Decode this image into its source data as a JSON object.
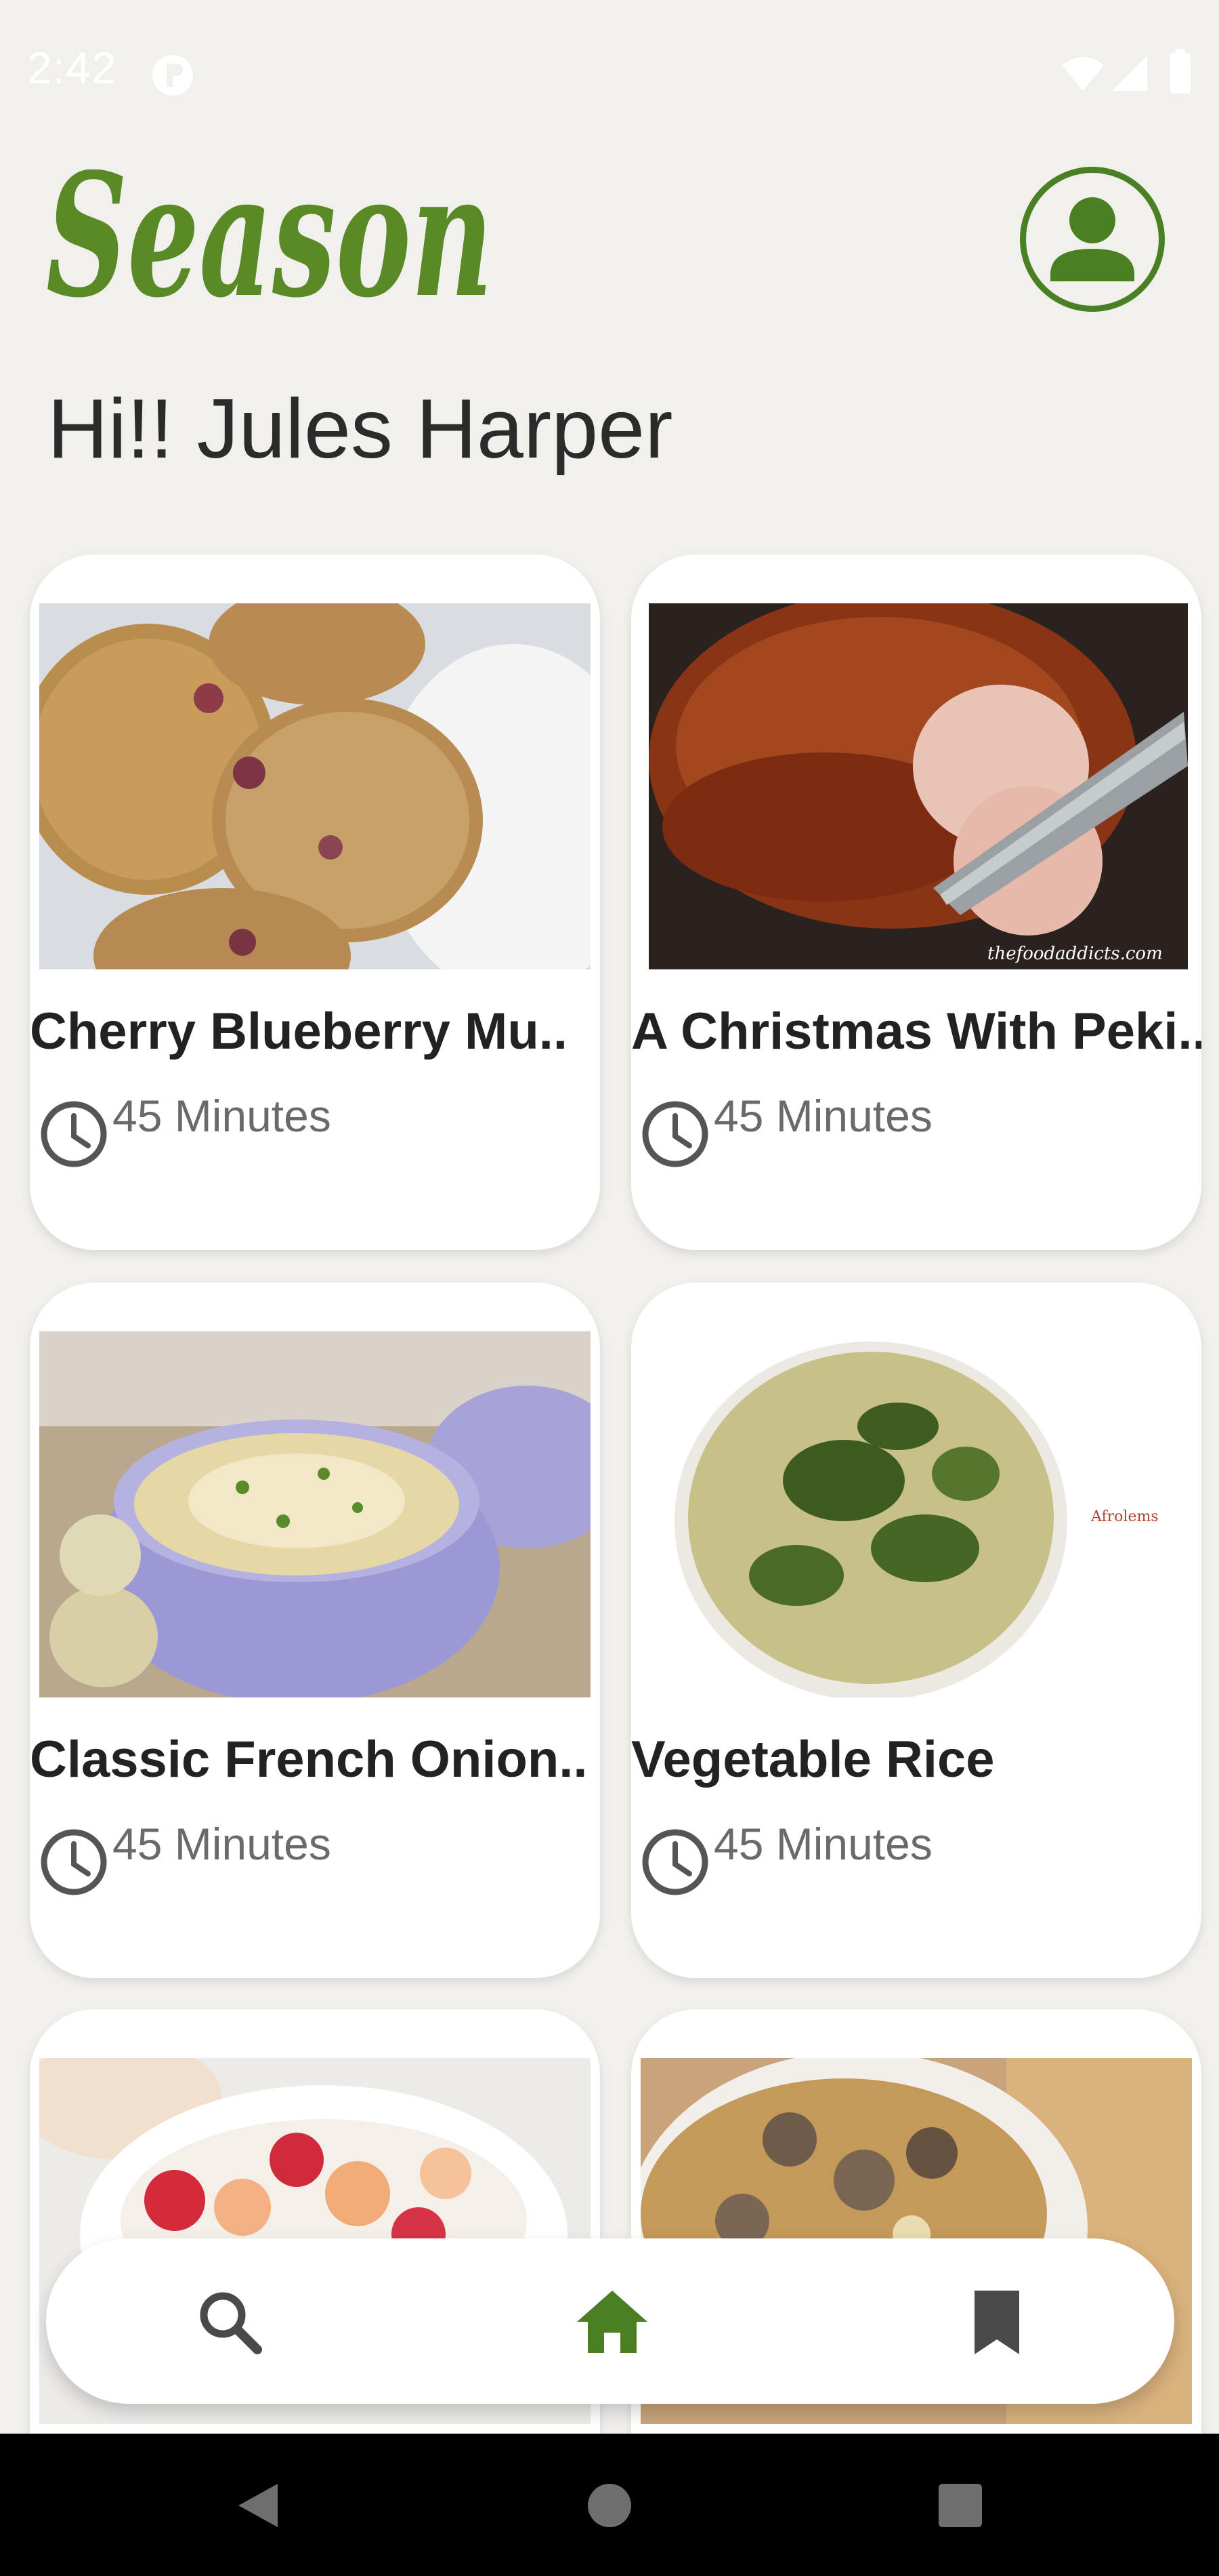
{
  "status_bar": {
    "time": "2:42",
    "icons": [
      "app-notification-icon",
      "wifi-icon",
      "cell-signal-icon",
      "battery-icon"
    ]
  },
  "header": {
    "logo_text": "Season",
    "greeting": "Hi!! Jules Harper",
    "profile_icon": "account-circle-icon"
  },
  "recipes": [
    {
      "title": "Cherry Blueberry Mu..",
      "time": "45 Minutes",
      "image": "muffins-photo"
    },
    {
      "title": "A Christmas With Peki..",
      "time": "45 Minutes",
      "image": "roast-duck-photo",
      "watermark": "thefoodaddicts.com"
    },
    {
      "title": "Classic French Onion..",
      "time": "45 Minutes",
      "image": "onion-soup-photo"
    },
    {
      "title": "Vegetable Rice",
      "time": "45 Minutes",
      "image": "vegetable-rice-photo",
      "watermark": "Afrolems"
    },
    {
      "title": "",
      "time": "",
      "image": "fruit-salad-photo"
    },
    {
      "title": "",
      "time": "",
      "image": "meat-dish-photo"
    }
  ],
  "bottom_nav": {
    "items": [
      {
        "icon": "search-icon",
        "active": false
      },
      {
        "icon": "home-icon",
        "active": true
      },
      {
        "icon": "bookmark-icon",
        "active": false
      }
    ]
  },
  "system_nav": [
    "back-icon",
    "home-circle-icon",
    "recents-icon"
  ],
  "colors": {
    "brand_green": "#5a8a26",
    "background": "#f2f0ed",
    "card": "#ffffff",
    "text_dark": "#222222",
    "text_muted": "#6a6a6a",
    "nav_inactive": "#444444"
  }
}
